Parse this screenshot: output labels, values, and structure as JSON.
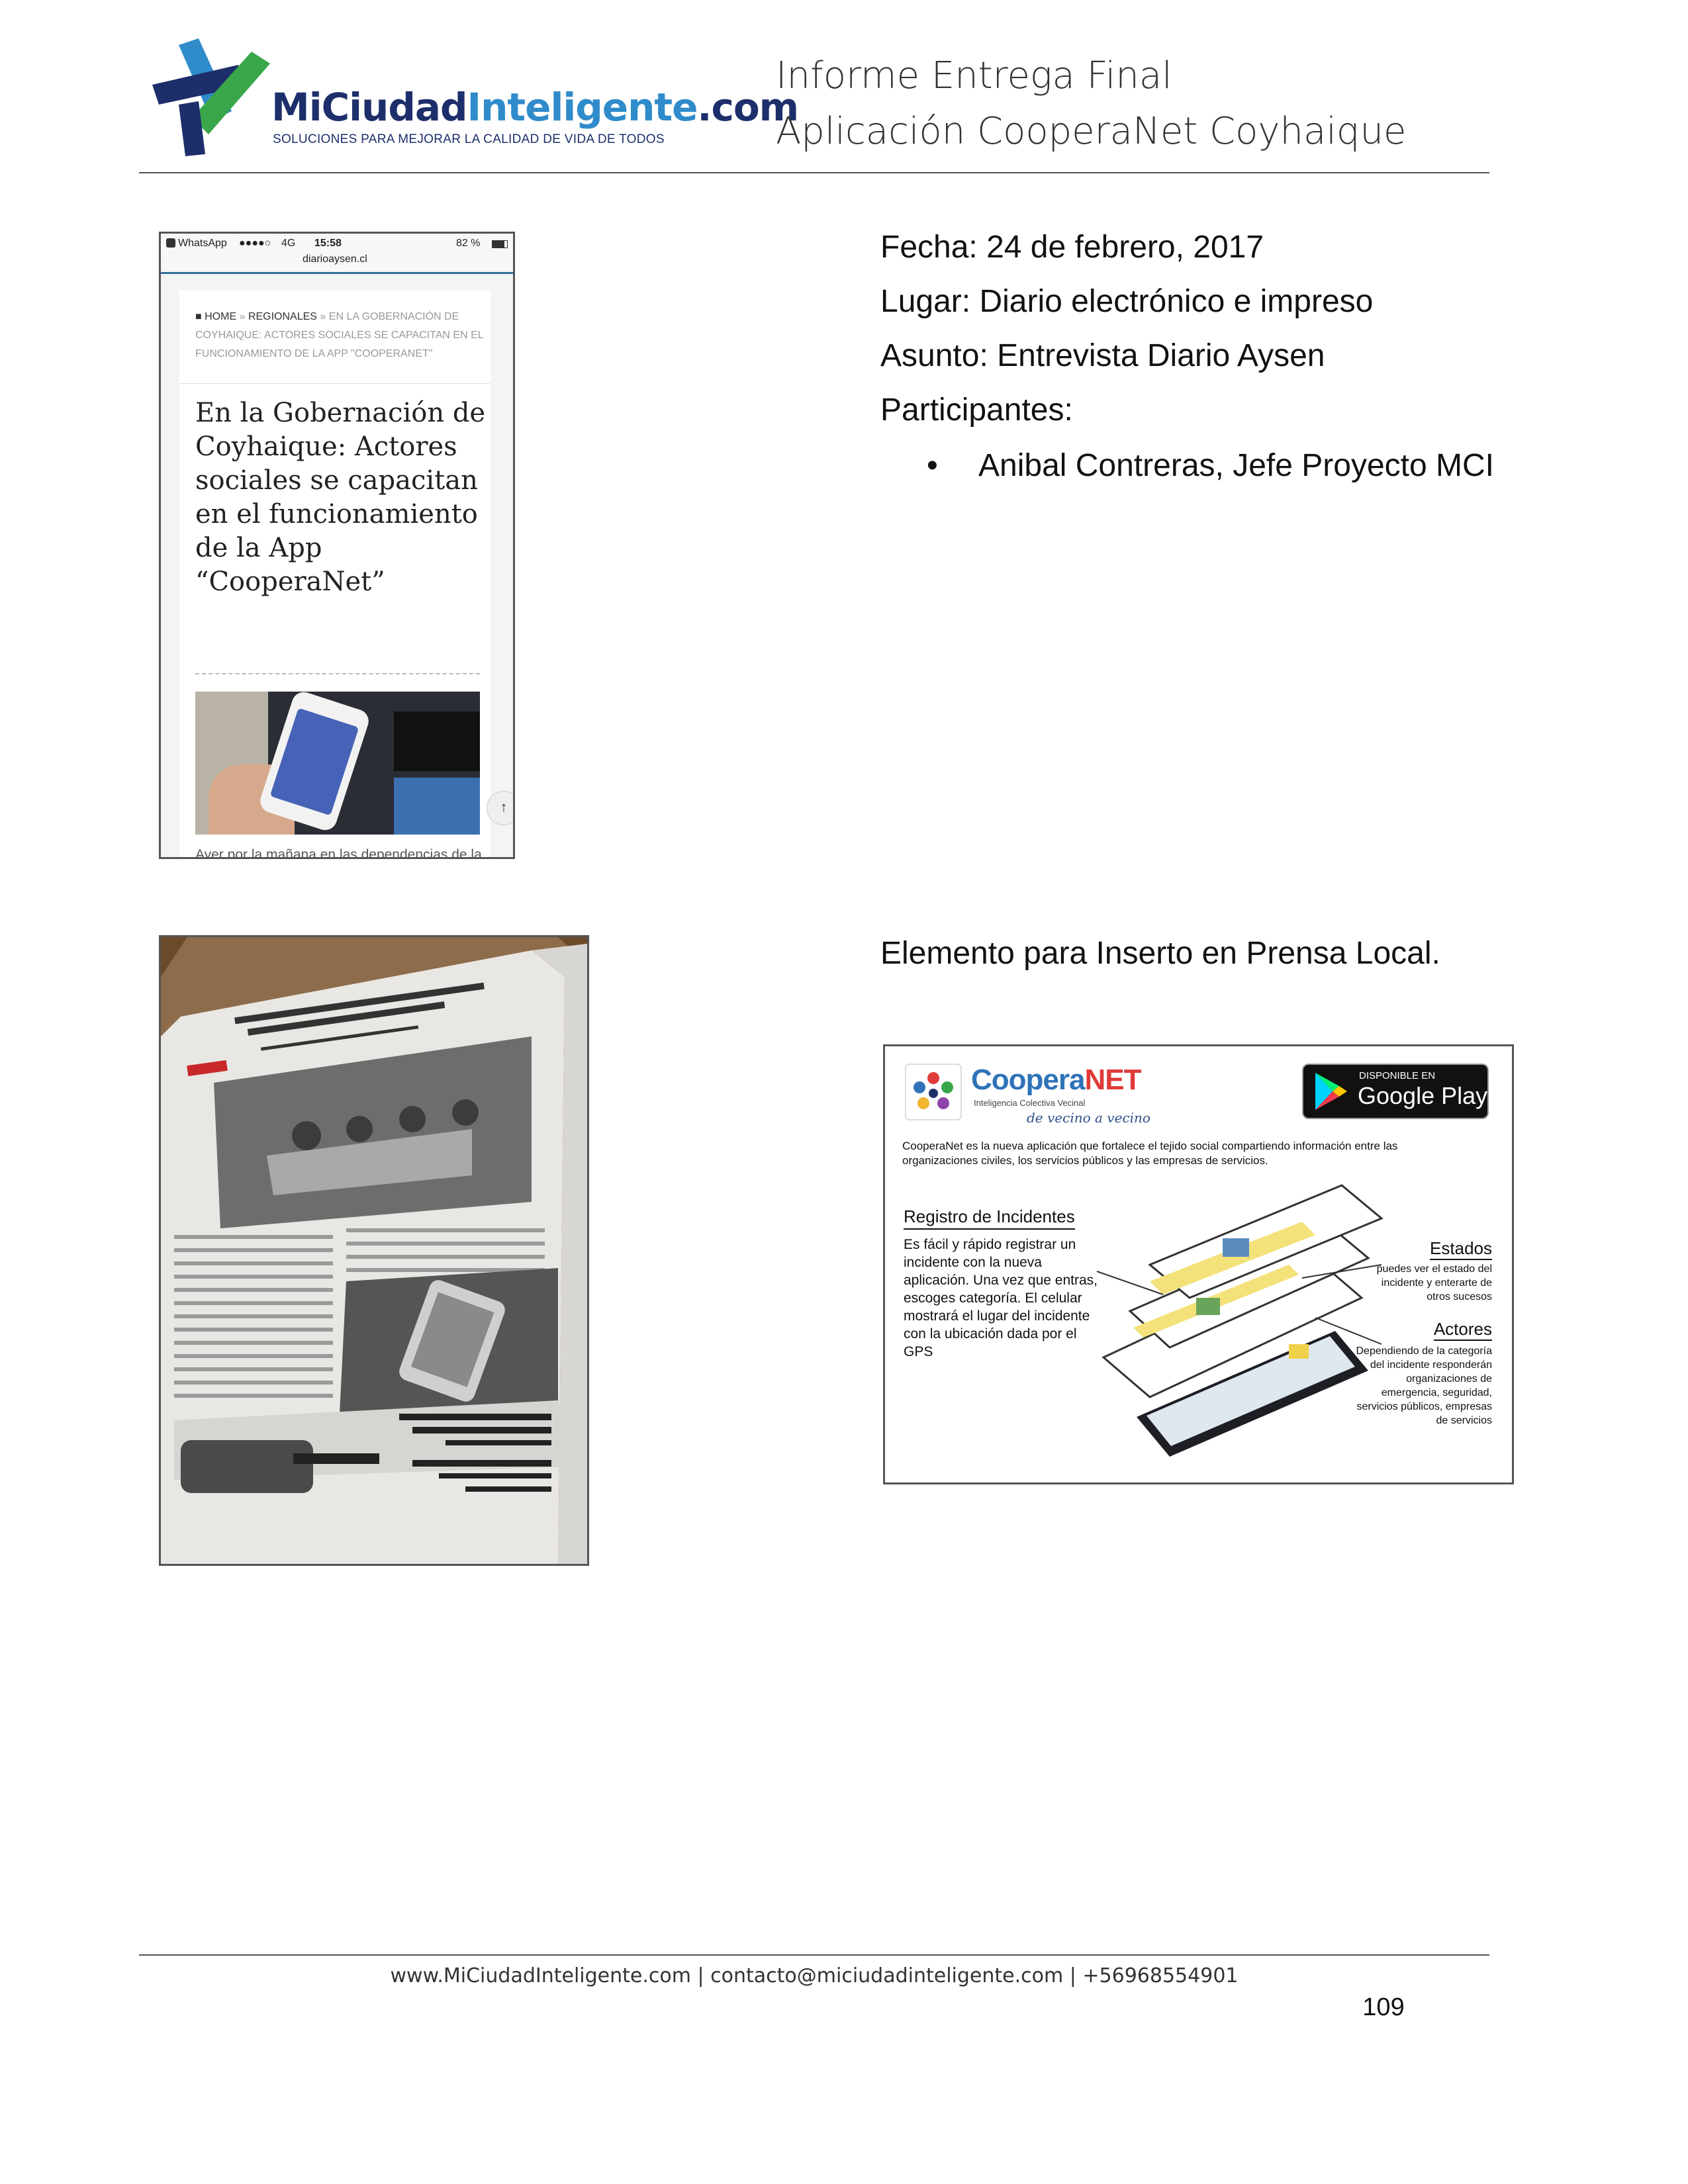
{
  "header": {
    "logo_name_prefix": "MiCiudad",
    "logo_name_highlight": "Inteligente",
    "logo_name_suffix": ".com",
    "logo_tagline": "SOLUCIONES PARA MEJORAR LA CALIDAD DE VIDA DE TODOS",
    "title_line1": "Informe Entrega Final",
    "title_line2": "Aplicación CooperaNet Coyhaique"
  },
  "meeting": {
    "fecha": "Fecha: 24 de febrero, 2017",
    "lugar": "Lugar: Diario electrónico e impreso",
    "asunto": "Asunto: Entrevista Diario Aysen",
    "participantes_label": "Participantes:",
    "bullet": "•",
    "participantes": [
      "Anibal Contreras, Jefe Proyecto MCI"
    ]
  },
  "phone_screenshot": {
    "app": "WhatsApp",
    "signal": "●●●●○",
    "network": "4G",
    "time": "15:58",
    "battery": "82 %",
    "url": "diarioaysen.cl",
    "breadcrumb_home": "HOME",
    "breadcrumb_sep": "»",
    "breadcrumb_section": "REGIONALES",
    "breadcrumb_rest": "EN LA GOBERNACIÓN DE COYHAIQUE: ACTORES SOCIALES SE CAPACITAN EN EL FUNCIONAMIENTO DE LA APP \"COOPERANET\"",
    "headline": "En la Gobernación de Coyhaique: Actores sociales se capacitan en el funcionamiento de la App “CooperaNet”",
    "body": "Ayer por la mañana en las dependencias de la Gobernación Provincial de Coyhaique, funcionarios de Onemi, de la misma",
    "up_arrow": "↑"
  },
  "section2": {
    "caption": "Elemento para Inserto en Prensa Local."
  },
  "insert": {
    "brand_coopera": "Coopera",
    "brand_net": "NET",
    "brand_sub": "Inteligencia Colectiva Vecinal",
    "slogan": "de vecino a vecino",
    "store_small": "DISPONIBLE EN",
    "store_big": "Google Play",
    "description": "CooperaNet es la nueva aplicación que fortalece el tejido social compartiendo información entre las organizaciones civiles, los servicios públicos y las empresas de servicios.",
    "registro_heading": "Registro de Incidentes",
    "registro_text": "Es  fácil y rápido registrar un incidente con la nueva aplicación. Una vez que entras, escoges categoría. El celular mostrará el lugar del incidente con la ubicación dada por el GPS",
    "estados_heading": "Estados",
    "estados_text": "puedes ver el estado del incidente y enterarte de otros sucesos",
    "actores_heading": "Actores",
    "actores_text": "Dependiendo de la categoría del incidente responderán organizaciones de emergencia, seguridad, servicios públicos, empresas de servicios"
  },
  "footer": {
    "contact": "www.MiCiudadInteligente.com | contacto@miciudadinteligente.com | +56968554901",
    "page_number": "109"
  },
  "colors": {
    "logo_navy": "#1d2f6b",
    "logo_blue": "#2f8bc9",
    "logo_green": "#3aa64a",
    "brand_blue": "#2e73b8",
    "brand_red": "#e03a3a"
  }
}
